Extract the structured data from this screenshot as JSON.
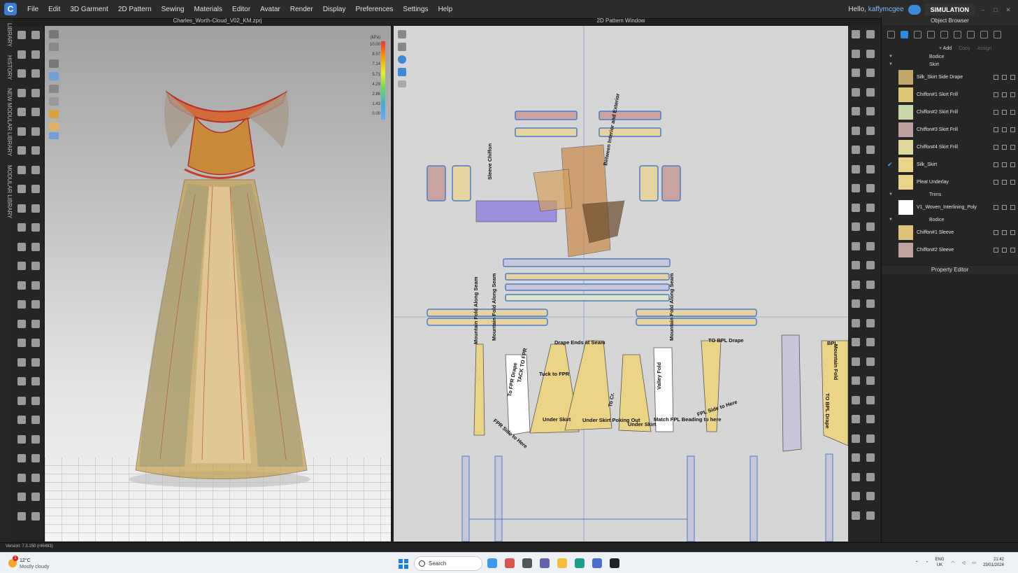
{
  "menu": {
    "items": [
      "File",
      "Edit",
      "3D Garment",
      "2D Pattern",
      "Sewing",
      "Materials",
      "Editor",
      "Avatar",
      "Render",
      "Display",
      "Preferences",
      "Settings",
      "Help"
    ],
    "greeting": "Hello,",
    "username": "kaffymcgee",
    "mode": "SIMULATION"
  },
  "left_tabs": [
    "LIBRARY",
    "HISTORY",
    "NEW MODULAR LIBRARY",
    "MODULAR LIBRARY"
  ],
  "view3d": {
    "title": "Charles_Worth-Cloud_V02_KM.zprj",
    "legend_unit": "(kPa)",
    "legend_values": [
      "10.00",
      "8.57",
      "7.14",
      "5.71",
      "4.29",
      "2.86",
      "1.43",
      "0.00"
    ]
  },
  "view2d": {
    "title": "2D Pattern Window",
    "labels": [
      "Between Interior and Exterior",
      "Sleeve Chiffon",
      "Mountain Fold Along Seam",
      "Mountain Fold Along Seam",
      "Mountain Fold Along Seam",
      "Drape Ends at Seam",
      "TO BPL Drape",
      "To FPR Drape",
      "TACK TO FPR",
      "Under Skirt",
      "Under Skirt Poking Out",
      "Under Skirt",
      "Match FPL Beading to here",
      "FPL Side to Here",
      "FPR Side to Here",
      "Mountain Fold",
      "TO BPL Drape",
      "BPL",
      "Tuck to FPR",
      "Valley Fold",
      "To Cr."
    ]
  },
  "object_browser": {
    "title": "Object Browser",
    "add_label": "+ Add",
    "copy_label": "Copy",
    "assign_label": "Assign",
    "groups": [
      {
        "name": "Bodice",
        "items": []
      },
      {
        "name": "Skirt",
        "items": [
          {
            "name": "Silk_Skirt Side Drape",
            "color": "#c4a86a"
          },
          {
            "name": "Chiffon#1 Skirt Frill",
            "color": "#e0c677"
          },
          {
            "name": "Chiffon#2 Skirt Frill",
            "color": "#c9d7a6"
          },
          {
            "name": "Chiffon#3 Skirt Frill",
            "color": "#bfa0a0"
          },
          {
            "name": "Chiffon#4 Skirt Frill",
            "color": "#e0d69a"
          },
          {
            "name": "Silk_Skirt",
            "color": "#ecd487",
            "checked": true
          },
          {
            "name": "Pleat Underlay",
            "color": "#ecd487"
          }
        ]
      },
      {
        "name": "Trims",
        "items": [
          {
            "name": "V1_Woven_Interlining_Poly",
            "color": "#ffffff"
          }
        ]
      },
      {
        "name": "Bodice",
        "items": [
          {
            "name": "Chiffon#1 Sleeve",
            "color": "#ddc27a"
          },
          {
            "name": "Chiffon#2 Sleeve",
            "color": "#c1a0a0"
          }
        ]
      }
    ]
  },
  "property_editor": {
    "title": "Property Editor"
  },
  "status": {
    "version": "Version: 7.3.150 (r46483)"
  },
  "taskbar": {
    "temp": "12°C",
    "weather": "Mostly cloudy",
    "notification_count": "1",
    "search_placeholder": "Search",
    "lang": "ENG",
    "region": "UK",
    "time": "21:42",
    "date": "23/01/2024"
  }
}
